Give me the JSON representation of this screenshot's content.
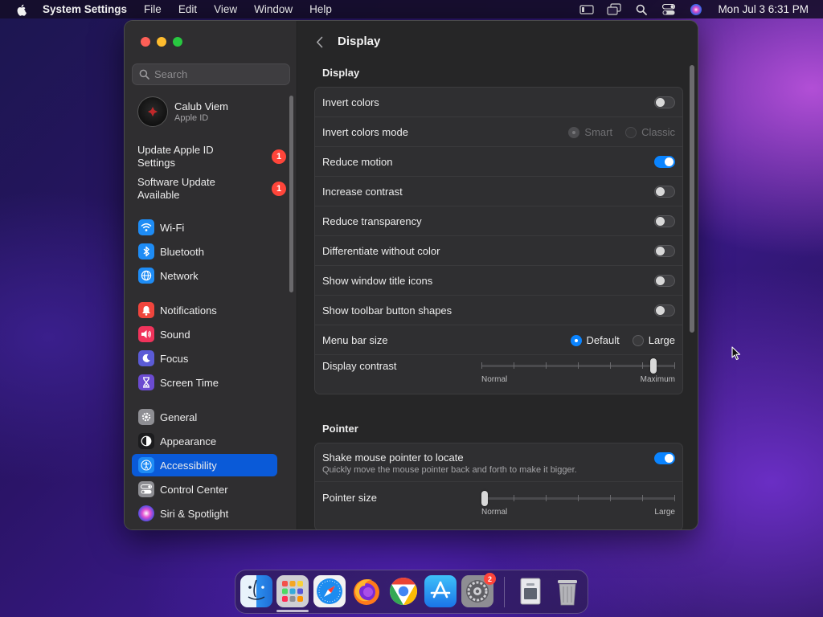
{
  "menubar": {
    "app_name": "System Settings",
    "items": [
      "File",
      "Edit",
      "View",
      "Window",
      "Help"
    ],
    "clock": "Mon Jul 3  6:31 PM"
  },
  "sidebar": {
    "search_placeholder": "Search",
    "account": {
      "name": "Calub Viem",
      "subtitle": "Apple ID"
    },
    "notices": [
      {
        "label": "Update Apple ID Settings",
        "badge": "1"
      },
      {
        "label": "Software Update Available",
        "badge": "1"
      }
    ],
    "items": [
      {
        "label": "Wi-Fi",
        "icon": "wifi-icon",
        "color": "#1e8cf5"
      },
      {
        "label": "Bluetooth",
        "icon": "bluetooth-icon",
        "color": "#1e8cf5"
      },
      {
        "label": "Network",
        "icon": "globe-icon",
        "color": "#1e8cf5"
      },
      {
        "label": "Notifications",
        "icon": "bell-icon",
        "color": "#f0453d"
      },
      {
        "label": "Sound",
        "icon": "speaker-icon",
        "color": "#f0335b"
      },
      {
        "label": "Focus",
        "icon": "moon-icon",
        "color": "#5b5bd6"
      },
      {
        "label": "Screen Time",
        "icon": "hourglass-icon",
        "color": "#6b4bd0"
      },
      {
        "label": "General",
        "icon": "gear-icon",
        "color": "#8e8e93"
      },
      {
        "label": "Appearance",
        "icon": "appearance-icon",
        "color": "#1c1c1e"
      },
      {
        "label": "Accessibility",
        "icon": "accessibility-icon",
        "color": "#1e8cf5"
      },
      {
        "label": "Control Center",
        "icon": "control-center-icon",
        "color": "#8e8e93"
      },
      {
        "label": "Siri & Spotlight",
        "icon": "siri-icon",
        "color": "#7a3ae0"
      }
    ],
    "active_item": "Accessibility"
  },
  "main": {
    "title": "Display",
    "display_section": {
      "title": "Display",
      "invert_colors": {
        "label": "Invert colors",
        "on": false
      },
      "invert_colors_mode": {
        "label": "Invert colors mode",
        "options": [
          "Smart",
          "Classic"
        ],
        "selected": "Smart",
        "enabled": false
      },
      "reduce_motion": {
        "label": "Reduce motion",
        "on": true
      },
      "increase_contrast": {
        "label": "Increase contrast",
        "on": false
      },
      "reduce_transparency": {
        "label": "Reduce transparency",
        "on": false
      },
      "differentiate_without_color": {
        "label": "Differentiate without color",
        "on": false
      },
      "show_window_title_icons": {
        "label": "Show window title icons",
        "on": false
      },
      "show_toolbar_button_shapes": {
        "label": "Show toolbar button shapes",
        "on": false
      },
      "menu_bar_size": {
        "label": "Menu bar size",
        "options": [
          "Default",
          "Large"
        ],
        "selected": "Default"
      },
      "display_contrast": {
        "label": "Display contrast",
        "min_label": "Normal",
        "max_label": "Maximum",
        "value": 0.9
      }
    },
    "pointer_section": {
      "title": "Pointer",
      "shake_to_locate": {
        "label": "Shake mouse pointer to locate",
        "description": "Quickly move the mouse pointer back and forth to make it bigger.",
        "on": true
      },
      "pointer_size": {
        "label": "Pointer size",
        "min_label": "Normal",
        "max_label": "Large",
        "value": 0.0
      }
    }
  },
  "dock": {
    "apps": [
      "Finder",
      "Launchpad",
      "Safari",
      "Firefox",
      "Chrome",
      "App Store",
      "System Settings",
      "Preview",
      "Trash"
    ],
    "settings_badge": "2"
  }
}
